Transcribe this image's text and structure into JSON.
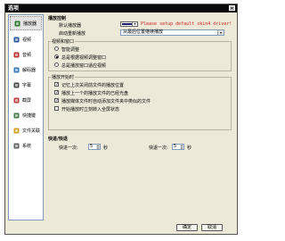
{
  "window": {
    "title": "选项",
    "close_glyph": "×"
  },
  "sidebar": {
    "items": [
      {
        "label": "播放器",
        "icon": "player-icon",
        "color": "#2a7a2a",
        "selected": true
      },
      {
        "label": "视频",
        "icon": "video-icon",
        "color": "#2a5a9a"
      },
      {
        "label": "音频",
        "icon": "audio-icon",
        "color": "#c03030"
      },
      {
        "label": "解码器",
        "icon": "decoder-icon",
        "color": "#3a7ab8"
      },
      {
        "label": "字幕",
        "icon": "subtitle-icon",
        "color": "#4a4a4a"
      },
      {
        "label": "截屏",
        "icon": "screenshot-icon",
        "color": "#c04040"
      },
      {
        "label": "快捷键",
        "icon": "keyboard-icon",
        "color": "#4a7a4a"
      },
      {
        "label": "文件关联",
        "icon": "file-assoc-icon",
        "color": "#d0a020"
      },
      {
        "label": "系统",
        "icon": "system-icon",
        "color": "#606060"
      }
    ]
  },
  "playback": {
    "section_title": "播放控制",
    "default_bg_label": "默认播放器",
    "bg_color": "#1a1a6e",
    "warning_text": "Please setup default skin4 driver!",
    "auto_hide_label": "启动重新播放",
    "auto_hide_value": "从最后位置继续播放"
  },
  "window_group": {
    "label": "视频和窗口",
    "options": [
      {
        "label": "智能调整",
        "checked": false
      },
      {
        "label": "总是根据视频调整窗口",
        "checked": true
      },
      {
        "label": "总是播放窗口适应视频",
        "checked": false
      }
    ]
  },
  "start_group": {
    "label": "播放开始时",
    "options": [
      {
        "label": "记忆上次关闭前文件的播放位置",
        "checked": true
      },
      {
        "label": "播放上一个的播放文件的已经光盘",
        "checked": true
      },
      {
        "label": "播放媒体文件时自动添加文件夹中类似的文件",
        "checked": true
      },
      {
        "label": "开始播放时立刻转入全屏状态",
        "checked": false
      }
    ]
  },
  "seek": {
    "section_title": "快进/快退",
    "forward_label": "快进一次:",
    "forward_value": "5",
    "forward_unit": "秒",
    "back_label": "快退一次:",
    "back_value": "5",
    "back_unit": "秒"
  },
  "buttons": {
    "ok": "确定",
    "cancel": "取消"
  }
}
